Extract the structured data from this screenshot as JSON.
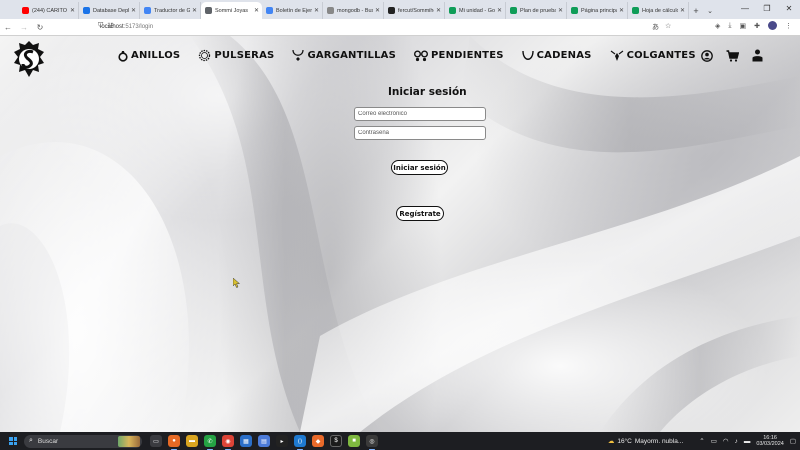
{
  "browser": {
    "tabs": [
      {
        "title": "(244) CARITO ®",
        "favicon_color": "#ff0000",
        "active": false
      },
      {
        "title": "Database Deploy",
        "favicon_color": "#1a73e8",
        "active": false
      },
      {
        "title": "Traductor de Go",
        "favicon_color": "#4285f4",
        "active": false
      },
      {
        "title": "Sommi Joyas",
        "favicon_color": "#5f6368",
        "active": true
      },
      {
        "title": "Boletín de Ejerc",
        "favicon_color": "#4285f4",
        "active": false
      },
      {
        "title": "mongodb - Busc",
        "favicon_color": "#888888",
        "active": false
      },
      {
        "title": "fercut/Sommiho",
        "favicon_color": "#222222",
        "active": false
      },
      {
        "title": "Mi unidad - Goo",
        "favicon_color": "#0f9d58",
        "active": false
      },
      {
        "title": "Plan de pruebas",
        "favicon_color": "#0f9d58",
        "active": false
      },
      {
        "title": "Página principal",
        "favicon_color": "#0f9d58",
        "active": false
      },
      {
        "title": "Hoja de cálculo",
        "favicon_color": "#0f9d58",
        "active": false
      }
    ],
    "url_host": "localhost",
    "url_path": ":5173/login"
  },
  "header": {
    "nav": [
      {
        "label": "ANILLOS",
        "icon": "ring-icon"
      },
      {
        "label": "PULSERAS",
        "icon": "bracelet-icon"
      },
      {
        "label": "GARGANTILLAS",
        "icon": "necklace-icon"
      },
      {
        "label": "PENDIENTES",
        "icon": "earrings-icon"
      },
      {
        "label": "CADENAS",
        "icon": "chain-icon"
      },
      {
        "label": "COLGANTES",
        "icon": "pendant-icon"
      }
    ]
  },
  "login": {
    "title": "Iniciar sesión",
    "email_placeholder": "Correo electrónico",
    "password_placeholder": "Contraseña",
    "submit_label": "Iniciar sesión",
    "register_label": "Regístrate"
  },
  "taskbar": {
    "search_placeholder": "Buscar",
    "weather_temp": "16°C",
    "weather_desc": "Mayorm. nubla...",
    "time": "16:16",
    "date": "03/03/2024"
  }
}
